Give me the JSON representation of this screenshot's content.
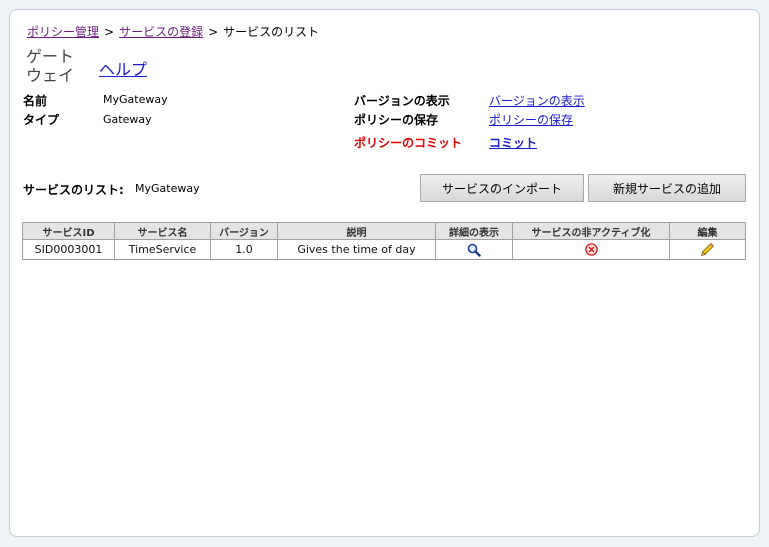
{
  "breadcrumb": {
    "items": [
      "ポリシー管理",
      "サービスの登録"
    ],
    "current": "サービスのリスト",
    "separator": ">"
  },
  "header": {
    "title": "ゲートウェイ",
    "help_label": "ヘルプ"
  },
  "details": {
    "name_label": "名前",
    "name_value": "MyGateway",
    "type_label": "タイプ",
    "type_value": "Gateway"
  },
  "actions": {
    "version_label": "バージョンの表示",
    "version_link": "バージョンの表示",
    "save_label": "ポリシーの保存",
    "save_link": "ポリシーの保存",
    "commit_label": "ポリシーのコミット",
    "commit_link": "コミット"
  },
  "service_list": {
    "label": "サービスのリスト:",
    "value": "MyGateway",
    "import_button": "サービスのインポート",
    "add_button": "新規サービスの追加"
  },
  "table": {
    "headers": [
      "サービスID",
      "サービス名",
      "バージョン",
      "説明",
      "詳細の表示",
      "サービスの非アクティブ化",
      "編集"
    ],
    "rows": [
      {
        "id": "SID0003001",
        "name": "TimeService",
        "version": "1.0",
        "description": "Gives the time of day",
        "details_icon": "magnifier-icon",
        "deactivate_icon": "deactivate-icon",
        "edit_icon": "pencil-icon"
      }
    ]
  },
  "colors": {
    "link": "#1a1acc",
    "visited_link": "#6b1c7a",
    "commit_red": "#e00000",
    "background": "#eef3f8"
  }
}
